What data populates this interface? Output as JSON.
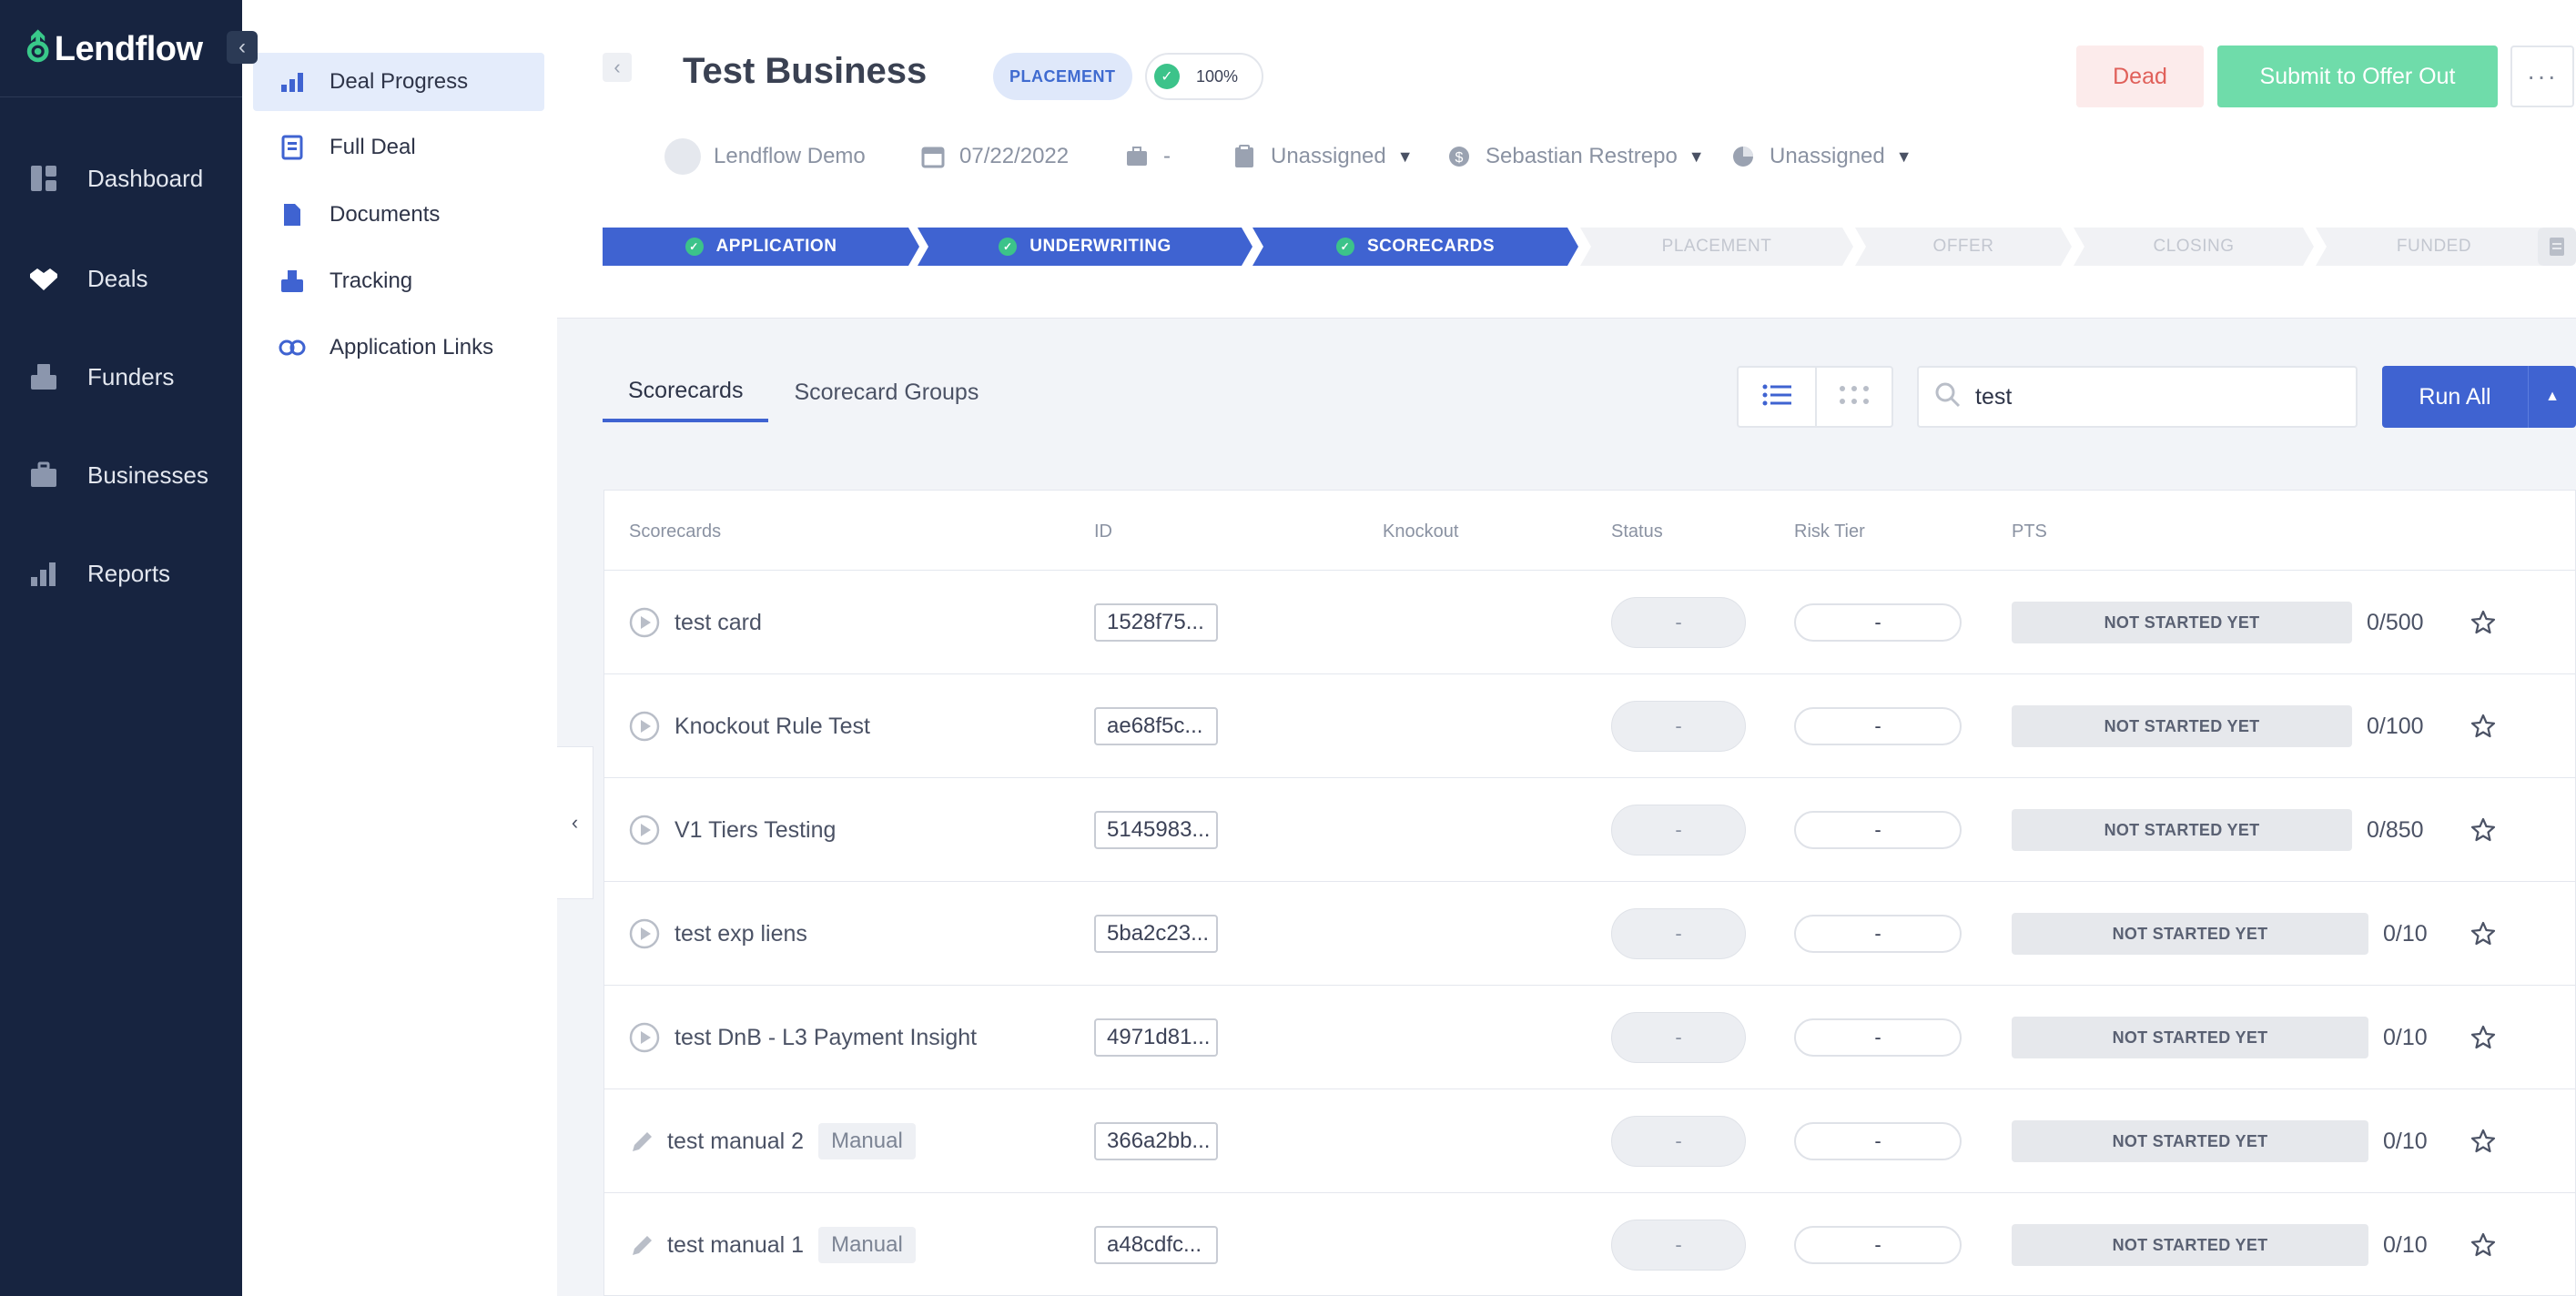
{
  "app": {
    "brand": "Lendflow"
  },
  "nav": {
    "items": [
      {
        "label": "Dashboard",
        "icon": "dashboard-icon"
      },
      {
        "label": "Deals",
        "icon": "handshake-icon"
      },
      {
        "label": "Funders",
        "icon": "inbox-icon"
      },
      {
        "label": "Businesses",
        "icon": "briefcase-icon"
      },
      {
        "label": "Reports",
        "icon": "bar-chart-icon"
      }
    ]
  },
  "subnav": {
    "items": [
      {
        "label": "Deal Progress",
        "icon": "progress-icon",
        "active": true
      },
      {
        "label": "Full Deal",
        "icon": "document-icon"
      },
      {
        "label": "Documents",
        "icon": "file-icon"
      },
      {
        "label": "Tracking",
        "icon": "tracking-icon"
      },
      {
        "label": "Application Links",
        "icon": "link-icon"
      }
    ]
  },
  "header": {
    "title": "Test Business",
    "stage_badge": "PLACEMENT",
    "progress": "100%",
    "dead_label": "Dead",
    "submit_label": "Submit to Offer Out",
    "more_label": "···",
    "meta": {
      "company": "Lendflow Demo",
      "date": "07/22/2022",
      "business_type": "-",
      "assignee_1": "Unassigned",
      "owner": "Sebastian Restrepo",
      "assignee_2": "Unassigned"
    },
    "steps": [
      {
        "label": "APPLICATION",
        "done": true
      },
      {
        "label": "UNDERWRITING",
        "done": true
      },
      {
        "label": "SCORECARDS",
        "done": true
      },
      {
        "label": "PLACEMENT",
        "done": false
      },
      {
        "label": "OFFER",
        "done": false
      },
      {
        "label": "CLOSING",
        "done": false
      },
      {
        "label": "FUNDED",
        "done": false
      }
    ]
  },
  "content": {
    "tabs": [
      "Scorecards",
      "Scorecard Groups"
    ],
    "search": {
      "value": "test"
    },
    "run_all": "Run All",
    "columns": [
      "Scorecards",
      "ID",
      "Knockout",
      "Status",
      "Risk Tier",
      "PTS"
    ],
    "rows": [
      {
        "name": "test card",
        "manual": "",
        "id": "1528f75...",
        "status": "-",
        "risk": "-",
        "pts": "NOT STARTED YET",
        "score": "0/500"
      },
      {
        "name": "Knockout Rule Test",
        "manual": "",
        "id": "ae68f5c...",
        "status": "-",
        "risk": "-",
        "pts": "NOT STARTED YET",
        "score": "0/100"
      },
      {
        "name": "V1 Tiers Testing",
        "manual": "",
        "id": "5145983...",
        "status": "-",
        "risk": "-",
        "pts": "NOT STARTED YET",
        "score": "0/850"
      },
      {
        "name": "test exp liens",
        "manual": "",
        "id": "5ba2c23...",
        "status": "-",
        "risk": "-",
        "pts": "NOT STARTED YET",
        "score": "0/10"
      },
      {
        "name": "test DnB - L3 Payment Insight",
        "manual": "",
        "id": "4971d81...",
        "status": "-",
        "risk": "-",
        "pts": "NOT STARTED YET",
        "score": "0/10"
      },
      {
        "name": "test manual 2",
        "manual": "Manual",
        "id": "366a2bb...",
        "status": "-",
        "risk": "-",
        "pts": "NOT STARTED YET",
        "score": "0/10"
      },
      {
        "name": "test manual 1",
        "manual": "Manual",
        "id": "a48cdfc...",
        "status": "-",
        "risk": "-",
        "pts": "NOT STARTED YET",
        "score": "0/10"
      }
    ]
  },
  "colors": {
    "sidebar": "#172440",
    "accent": "#3f63d1",
    "success": "#3cc38a",
    "danger": "#e0605a",
    "submit": "#6fdcaa"
  }
}
